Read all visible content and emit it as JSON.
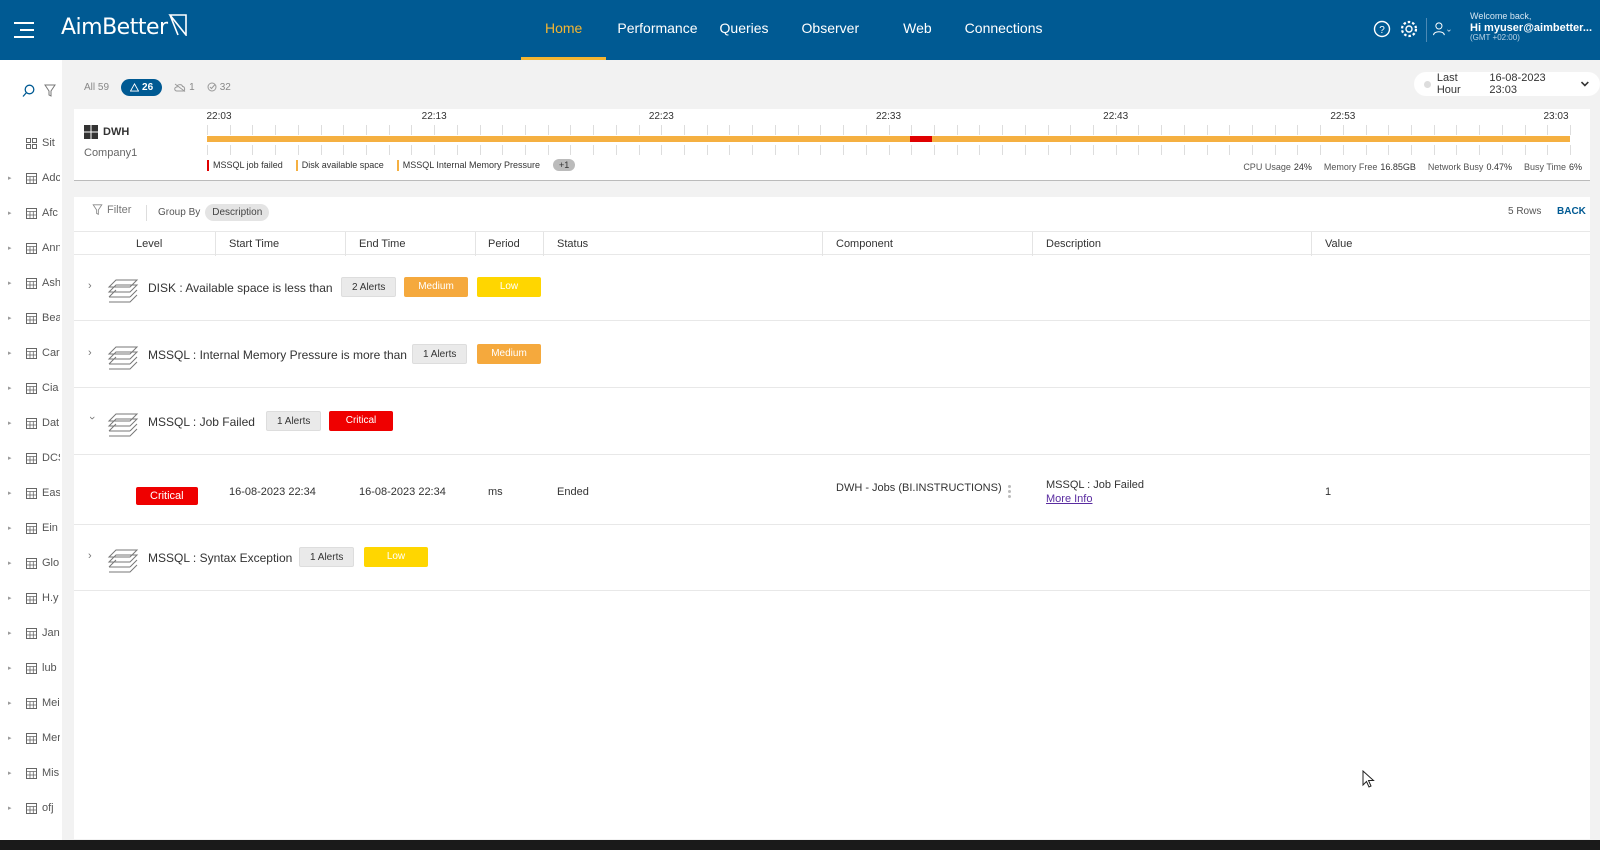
{
  "app": {
    "logo": "AimBetter"
  },
  "nav": {
    "items": [
      "Home",
      "Performance",
      "Queries",
      "Observer",
      "Web",
      "Connections"
    ],
    "active": "Home"
  },
  "user": {
    "welcome": "Welcome back,",
    "greeting": "Hi myuser@aimbetter...",
    "timezone": "(GMT +02:00)"
  },
  "sidebar": {
    "items": [
      {
        "label": "Sit",
        "icon": "grid-icon"
      },
      {
        "label": "Adc",
        "icon": "table-icon"
      },
      {
        "label": "Afc",
        "icon": "table-icon"
      },
      {
        "label": "Ann",
        "icon": "table-icon"
      },
      {
        "label": "Ash",
        "icon": "table-icon"
      },
      {
        "label": "Bea",
        "icon": "table-icon"
      },
      {
        "label": "Car",
        "icon": "table-icon"
      },
      {
        "label": "Cia",
        "icon": "table-icon"
      },
      {
        "label": "Dat",
        "icon": "table-icon"
      },
      {
        "label": "DCS",
        "icon": "table-icon"
      },
      {
        "label": "Eas",
        "icon": "table-icon"
      },
      {
        "label": "Ein",
        "icon": "table-icon"
      },
      {
        "label": "Glo",
        "icon": "table-icon"
      },
      {
        "label": "H.y",
        "icon": "table-icon"
      },
      {
        "label": "Jan",
        "icon": "table-icon"
      },
      {
        "label": "lub",
        "icon": "table-icon"
      },
      {
        "label": "Mei",
        "icon": "table-icon"
      },
      {
        "label": "Mer",
        "icon": "table-icon"
      },
      {
        "label": "Mis",
        "icon": "table-icon"
      },
      {
        "label": "ofj",
        "icon": "table-icon"
      }
    ]
  },
  "filters": {
    "all": "All 59",
    "alerts": "26",
    "cloud": "1",
    "ok": "32"
  },
  "time_picker": {
    "range": "Last Hour",
    "date": "16-08-2023 23:03"
  },
  "server": {
    "name": "DWH",
    "company": "Company1",
    "timeline_labels": [
      "22:03",
      "22:13",
      "22:23",
      "22:33",
      "22:43",
      "22:53",
      "23:03"
    ],
    "critical_marker": {
      "start_fraction": 0.516,
      "end_fraction": 0.532
    },
    "legend": [
      {
        "label": "MSSQL job failed",
        "color": "#e00000"
      },
      {
        "label": "Disk available space",
        "color": "#f5b041"
      },
      {
        "label": "MSSQL Internal Memory Pressure",
        "color": "#f5b041"
      }
    ],
    "legend_more": "+1",
    "metrics": [
      {
        "label": "CPU Usage",
        "value": "24%"
      },
      {
        "label": "Memory Free",
        "value": "16.85GB"
      },
      {
        "label": "Network Busy",
        "value": "0.47%"
      },
      {
        "label": "Busy Time",
        "value": "6%"
      }
    ]
  },
  "toolbar": {
    "filter": "Filter",
    "group_by": "Group By",
    "group_value": "Description",
    "rows": "5 Rows",
    "back": "BACK"
  },
  "columns": [
    "Level",
    "Start Time",
    "End Time",
    "Period",
    "Status",
    "Component",
    "Description",
    "Value"
  ],
  "groups": [
    {
      "title": "DISK : Available space is less than",
      "count": "2 Alerts",
      "badges": [
        "Medium",
        "Low"
      ],
      "expanded": false
    },
    {
      "title": "MSSQL : Internal Memory Pressure is more than",
      "count": "1 Alerts",
      "badges": [
        "Medium"
      ],
      "expanded": false
    },
    {
      "title": "MSSQL : Job Failed",
      "count": "1 Alerts",
      "badges": [
        "Critical"
      ],
      "expanded": true
    },
    {
      "title": "MSSQL : Syntax Exception",
      "count": "1 Alerts",
      "badges": [
        "Low"
      ],
      "expanded": false
    }
  ],
  "detail": {
    "level": "Critical",
    "start": "16-08-2023 22:34",
    "end": "16-08-2023 22:34",
    "period": "ms",
    "status": "Ended",
    "component": "DWH - Jobs (BI.INSTRUCTIONS)",
    "description": "MSSQL : Job Failed",
    "more_info": "More Info",
    "value": "1"
  },
  "colors": {
    "brand": "#005a93",
    "accent": "#f5b531",
    "medium": "#f5a93d",
    "low": "#ffd600",
    "critical": "#ef0000"
  }
}
